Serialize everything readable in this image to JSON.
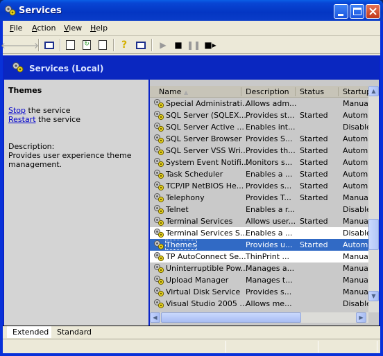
{
  "window": {
    "title": "Services",
    "icon": "services-gear-icon"
  },
  "menubar": [
    {
      "label": "File",
      "accel": "F"
    },
    {
      "label": "Action",
      "accel": "A"
    },
    {
      "label": "View",
      "accel": "V"
    },
    {
      "label": "Help",
      "accel": "H"
    }
  ],
  "toolbar": {
    "buttons": [
      "back-icon",
      "forward-icon",
      "show-hide-tree-icon",
      "properties-icon",
      "refresh-icon",
      "export-list-icon",
      "help-icon",
      "show-hide-action-pane-icon",
      "start-service-icon",
      "stop-service-icon",
      "pause-service-icon",
      "restart-service-icon"
    ]
  },
  "header": {
    "title": "Services (Local)"
  },
  "detail": {
    "service_name": "Themes",
    "stop_link": "Stop",
    "stop_suffix": " the service",
    "restart_link": "Restart",
    "restart_suffix": " the service",
    "description_label": "Description:",
    "description_line1": "Provides user experience theme",
    "description_line2": "management."
  },
  "list": {
    "columns": [
      "Name",
      "Description",
      "Status",
      "Startup"
    ],
    "sort_indicator": "▲",
    "rows": [
      {
        "name": "Special Administrati...",
        "desc": "Allows adm...",
        "status": "",
        "startup": "Manual"
      },
      {
        "name": "SQL Server (SQLEX...",
        "desc": "Provides st...",
        "status": "Started",
        "startup": "Automa"
      },
      {
        "name": "SQL Server Active ...",
        "desc": "Enables int...",
        "status": "",
        "startup": "Disabled"
      },
      {
        "name": "SQL Server Browser",
        "desc": "Provides S...",
        "status": "Started",
        "startup": "Automa"
      },
      {
        "name": "SQL Server VSS Wri...",
        "desc": "Provides th...",
        "status": "Started",
        "startup": "Automa"
      },
      {
        "name": "System Event Notifi...",
        "desc": "Monitors s...",
        "status": "Started",
        "startup": "Automa"
      },
      {
        "name": "Task Scheduler",
        "desc": "Enables a ...",
        "status": "Started",
        "startup": "Automa"
      },
      {
        "name": "TCP/IP NetBIOS He...",
        "desc": "Provides s...",
        "status": "Started",
        "startup": "Automa"
      },
      {
        "name": "Telephony",
        "desc": "Provides T...",
        "status": "Started",
        "startup": "Manual"
      },
      {
        "name": "Telnet",
        "desc": "Enables a r...",
        "status": "",
        "startup": "Disabled"
      },
      {
        "name": "Terminal Services",
        "desc": "Allows user...",
        "status": "Started",
        "startup": "Manual"
      },
      {
        "name": "Terminal Services S...",
        "desc": "Enables a ...",
        "status": "",
        "startup": "Disabled"
      },
      {
        "name": "Themes",
        "desc": "Provides u...",
        "status": "Started",
        "startup": "Automa",
        "selected": true
      },
      {
        "name": "TP AutoConnect Se...",
        "desc": "ThinPrint ...",
        "status": "",
        "startup": "Manual"
      },
      {
        "name": "Uninterruptible Pow...",
        "desc": "Manages a...",
        "status": "",
        "startup": "Manual"
      },
      {
        "name": "Upload Manager",
        "desc": "Manages t...",
        "status": "",
        "startup": "Manual"
      },
      {
        "name": "Virtual Disk Service",
        "desc": "Provides s...",
        "status": "",
        "startup": "Manual"
      },
      {
        "name": "Visual Studio 2005 ...",
        "desc": "Allows me...",
        "status": "",
        "startup": "Disabled"
      }
    ]
  },
  "tabs": [
    {
      "label": "Extended",
      "active": true
    },
    {
      "label": "Standard",
      "active": false
    }
  ],
  "colors": {
    "selection": "#316ac5",
    "titlebar": "#0436c3",
    "link": "#0000cc"
  }
}
